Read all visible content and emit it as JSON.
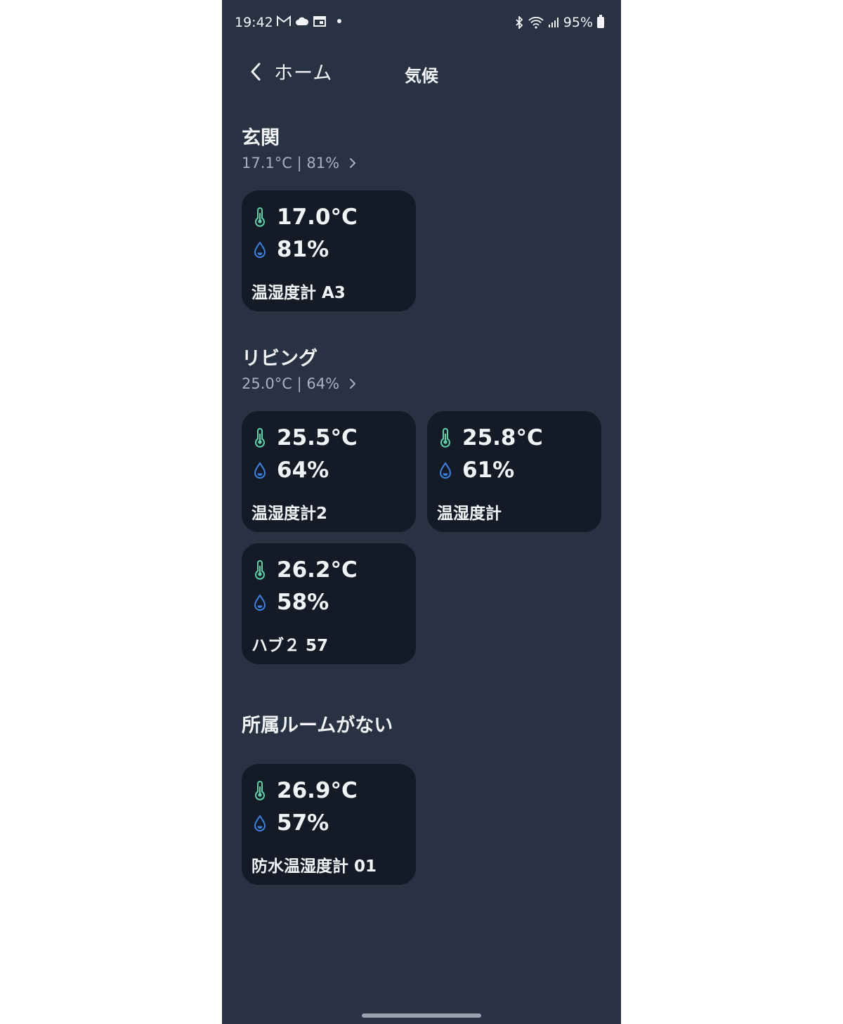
{
  "status_bar": {
    "time": "19:42",
    "battery": "95%",
    "left_icons": [
      "gmail-icon",
      "cloud-icon",
      "calendar-icon",
      "notification-dot"
    ],
    "right_icons": [
      "bluetooth-icon",
      "wifi-icon",
      "signal-icon",
      "battery-icon"
    ]
  },
  "header": {
    "back_label": "ホーム",
    "title": "気候"
  },
  "colors": {
    "background": "#283243",
    "card": "#141b26",
    "thermometer": "#5cd4a8",
    "droplet": "#3b82e6",
    "summary_text": "#a7b0bf"
  },
  "sections": [
    {
      "title": "玄関",
      "summary": "17.1°C | 81%",
      "cards": [
        {
          "temperature": "17.0°C",
          "humidity": "81%",
          "name": "温湿度計 A3"
        }
      ]
    },
    {
      "title": "リビング",
      "summary": "25.0°C | 64%",
      "cards": [
        {
          "temperature": "25.5°C",
          "humidity": "64%",
          "name": "温湿度計2"
        },
        {
          "temperature": "25.8°C",
          "humidity": "61%",
          "name": "温湿度計"
        },
        {
          "temperature": "26.2°C",
          "humidity": "58%",
          "name": "ハブ２ 57"
        }
      ]
    },
    {
      "title": "所属ルームがない",
      "cards": [
        {
          "temperature": "26.9°C",
          "humidity": "57%",
          "name": "防水温湿度計 01"
        }
      ]
    }
  ]
}
